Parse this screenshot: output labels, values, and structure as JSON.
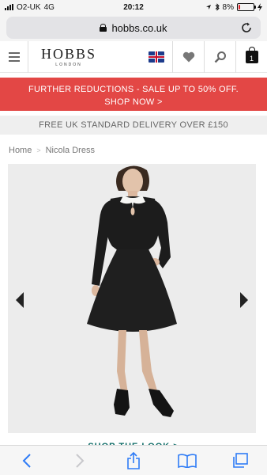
{
  "status": {
    "carrier": "O2-UK",
    "network": "4G",
    "time": "20:12",
    "battery": "8%",
    "battery_level": 0.08
  },
  "browser": {
    "url": "hobbs.co.uk"
  },
  "header": {
    "logo": "HOBBS",
    "logo_sub": "LONDON",
    "bag_count": "1"
  },
  "promo": {
    "line1": "FURTHER REDUCTIONS - SALE UP TO 50% OFF.",
    "line2": "SHOP NOW >"
  },
  "delivery": {
    "text": "FREE UK STANDARD DELIVERY OVER £150"
  },
  "breadcrumb": {
    "home": "Home",
    "current": "Nicola Dress"
  },
  "product": {
    "shop_the_look": "SHOP THE LOOK >"
  },
  "colors": {
    "promo_bg": "#e34745",
    "accent_teal": "#0d6b66",
    "ios_blue": "#2f7cf6"
  }
}
